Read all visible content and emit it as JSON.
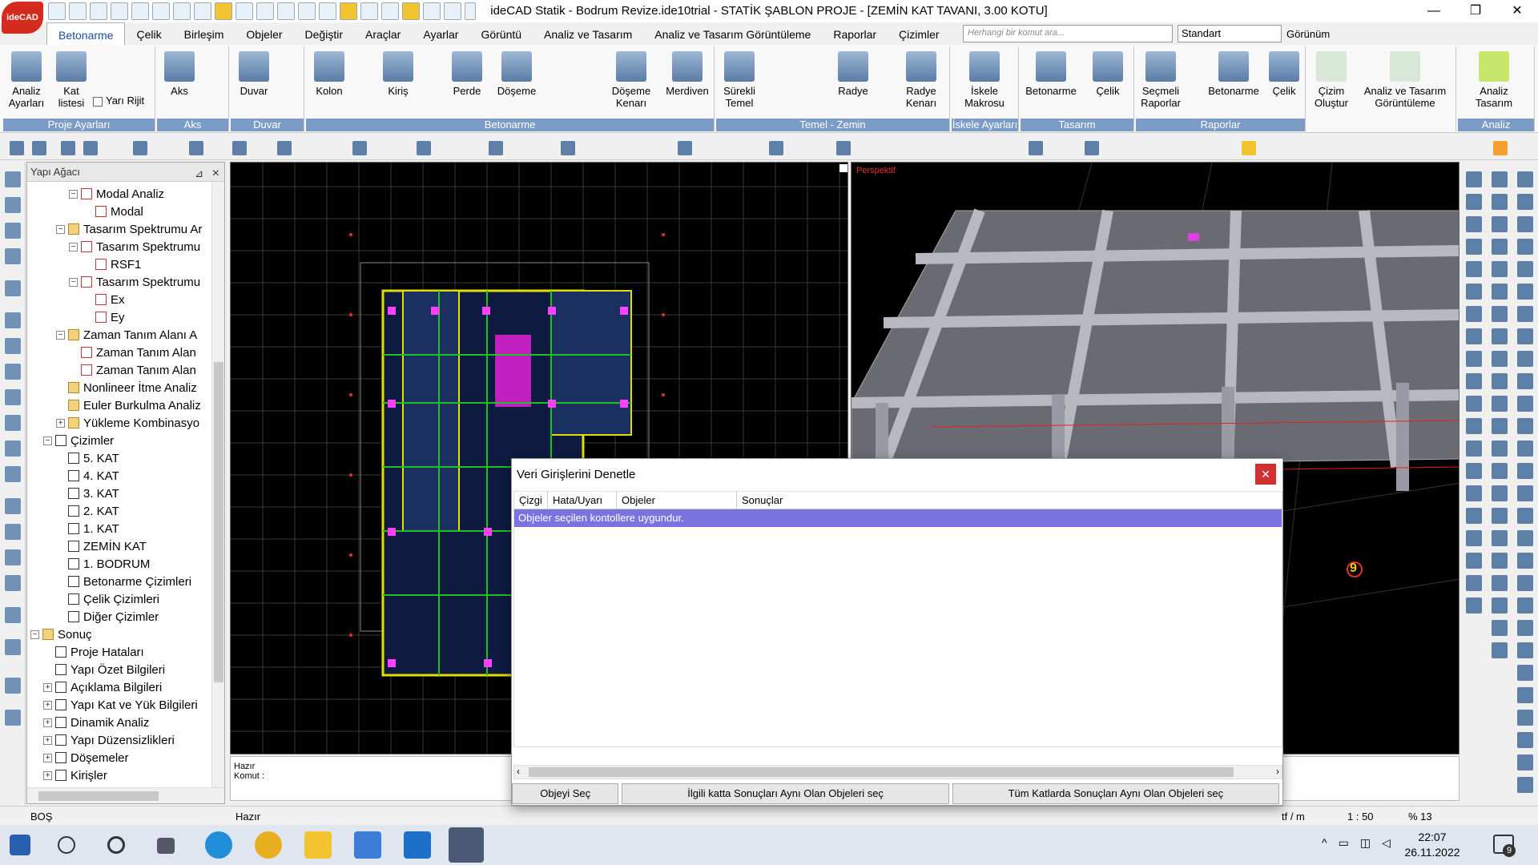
{
  "app": {
    "logo": "ideCAD",
    "title": "ideCAD Statik - Bodrum Revize.ide10trial - STATİK ŞABLON PROJE - [ZEMİN KAT TAVANI,  3.00 KOTU]",
    "min": "—",
    "max": "❐",
    "close": "✕"
  },
  "tabs": [
    "Betonarme",
    "Çelik",
    "Birleşim",
    "Objeler",
    "Değiştir",
    "Araçlar",
    "Ayarlar",
    "Görüntü",
    "Analiz ve Tasarım",
    "Analiz ve Tasarım Görüntüleme",
    "Raporlar",
    "Çizimler"
  ],
  "command_search": {
    "placeholder": "Herhangi bir komut ara..."
  },
  "style_select": "Standart",
  "view_menu": "Görünüm",
  "ribbon": {
    "groups": [
      {
        "caption": "Proje Ayarları",
        "buttons": [
          "Analiz Ayarları",
          "Kat listesi",
          "Yarı Rijit"
        ]
      },
      {
        "caption": "Aks",
        "buttons": [
          "Aks"
        ]
      },
      {
        "caption": "Duvar",
        "buttons": [
          "Duvar"
        ]
      },
      {
        "caption": "Betonarme",
        "buttons": [
          "Kolon",
          "Kiriş",
          "Perde",
          "Döşeme",
          "Döşeme Kenarı",
          "Merdiven"
        ]
      },
      {
        "caption": "Temel - Zemin",
        "buttons": [
          "Sürekli Temel",
          "Radye",
          "Radye Kenarı"
        ]
      },
      {
        "caption": "İskele Ayarları",
        "buttons": [
          "İskele Makrosu"
        ]
      },
      {
        "caption": "Tasarım",
        "buttons": [
          "Betonarme",
          "Çelik"
        ]
      },
      {
        "caption": "Raporlar",
        "buttons": [
          "Seçmeli Raporlar",
          "Betonarme",
          "Çelik"
        ]
      },
      {
        "caption": "",
        "buttons": [
          "Çizim Oluştur",
          "Analiz ve Tasarım Görüntüleme"
        ]
      },
      {
        "caption": "Analiz",
        "buttons": [
          "Analiz Tasarım"
        ]
      }
    ]
  },
  "tree": {
    "header": "Yapı Ağacı",
    "items": [
      {
        "label": "Modal Analiz",
        "exp": "−",
        "icon": "chart"
      },
      {
        "label": "Modal",
        "exp": "",
        "icon": "chart"
      },
      {
        "label": "Tasarım Spektrumu Ar",
        "exp": "−",
        "icon": "fold"
      },
      {
        "label": "Tasarım Spektrumu",
        "exp": "−",
        "icon": "chart"
      },
      {
        "label": "RSF1",
        "exp": "",
        "icon": "chart"
      },
      {
        "label": "Tasarım Spektrumu",
        "exp": "−",
        "icon": "chart"
      },
      {
        "label": "Ex",
        "exp": "",
        "icon": "chart"
      },
      {
        "label": "Ey",
        "exp": "",
        "icon": "chart"
      },
      {
        "label": "Zaman Tanım Alanı A",
        "exp": "−",
        "icon": "fold"
      },
      {
        "label": "Zaman Tanım Alan",
        "exp": "",
        "icon": "chart"
      },
      {
        "label": "Zaman Tanım Alan",
        "exp": "",
        "icon": "chart"
      },
      {
        "label": "Nonlineer İtme Analiz",
        "exp": "",
        "icon": "fold"
      },
      {
        "label": "Euler Burkulma Analiz",
        "exp": "",
        "icon": "fold"
      },
      {
        "label": "Yükleme Kombinasyo",
        "exp": "+",
        "icon": "fold"
      },
      {
        "label": "Çizimler",
        "exp": "−",
        "icon": "page"
      },
      {
        "label": "5. KAT",
        "exp": "",
        "icon": "page"
      },
      {
        "label": "4. KAT",
        "exp": "",
        "icon": "page"
      },
      {
        "label": "3. KAT",
        "exp": "",
        "icon": "page"
      },
      {
        "label": "2. KAT",
        "exp": "",
        "icon": "page"
      },
      {
        "label": "1. KAT",
        "exp": "",
        "icon": "page"
      },
      {
        "label": "ZEMİN KAT",
        "exp": "",
        "icon": "page"
      },
      {
        "label": "1. BODRUM",
        "exp": "",
        "icon": "page"
      },
      {
        "label": "Betonarme Çizimleri",
        "exp": "",
        "icon": "page"
      },
      {
        "label": "Çelik Çizimleri",
        "exp": "",
        "icon": "page"
      },
      {
        "label": "Diğer Çizimler",
        "exp": "",
        "icon": "page"
      },
      {
        "label": "Sonuç",
        "exp": "−",
        "icon": "fold"
      },
      {
        "label": "Proje Hataları",
        "exp": "",
        "icon": "page"
      },
      {
        "label": "Yapı Özet Bilgileri",
        "exp": "",
        "icon": "page"
      },
      {
        "label": "Açıklama Bilgileri",
        "exp": "+",
        "icon": "page"
      },
      {
        "label": "Yapı Kat ve Yük Bilgileri",
        "exp": "+",
        "icon": "page"
      },
      {
        "label": "Dinamik Analiz",
        "exp": "+",
        "icon": "page"
      },
      {
        "label": "Yapı Düzensizlikleri",
        "exp": "+",
        "icon": "page"
      },
      {
        "label": "Döşemeler",
        "exp": "+",
        "icon": "page"
      },
      {
        "label": "Kirişler",
        "exp": "+",
        "icon": "page"
      }
    ]
  },
  "viewport3d": {
    "label": "Perspektif",
    "marker": "9"
  },
  "command": {
    "line1": "Hazır",
    "line2": "Komut :"
  },
  "dialog": {
    "title": "Veri Girişlerini Denetle",
    "columns": [
      "Çizgi",
      "Hata/Uyarı",
      "Objeler",
      "Sonuçlar"
    ],
    "row": "Objeler seçilen kontollere uygundur.",
    "buttons": [
      "Objeyi Seç",
      "İlgili katta Sonuçları Aynı Olan Objeleri seç",
      "Tüm Katlarda Sonuçları Aynı Olan Objeleri seç"
    ]
  },
  "status": {
    "left": "BOŞ",
    "mid": "Hazır",
    "unit": "tf / m",
    "scale": "1 : 50",
    "zoom": "% 13"
  },
  "taskbar": {
    "time": "22:07",
    "date": "26.11.2022",
    "badge": "9"
  },
  "colors": {
    "ribbon_caption": "#7a9cc6",
    "dialog_row": "#7b74e0",
    "accent": "#1a4ea0"
  }
}
